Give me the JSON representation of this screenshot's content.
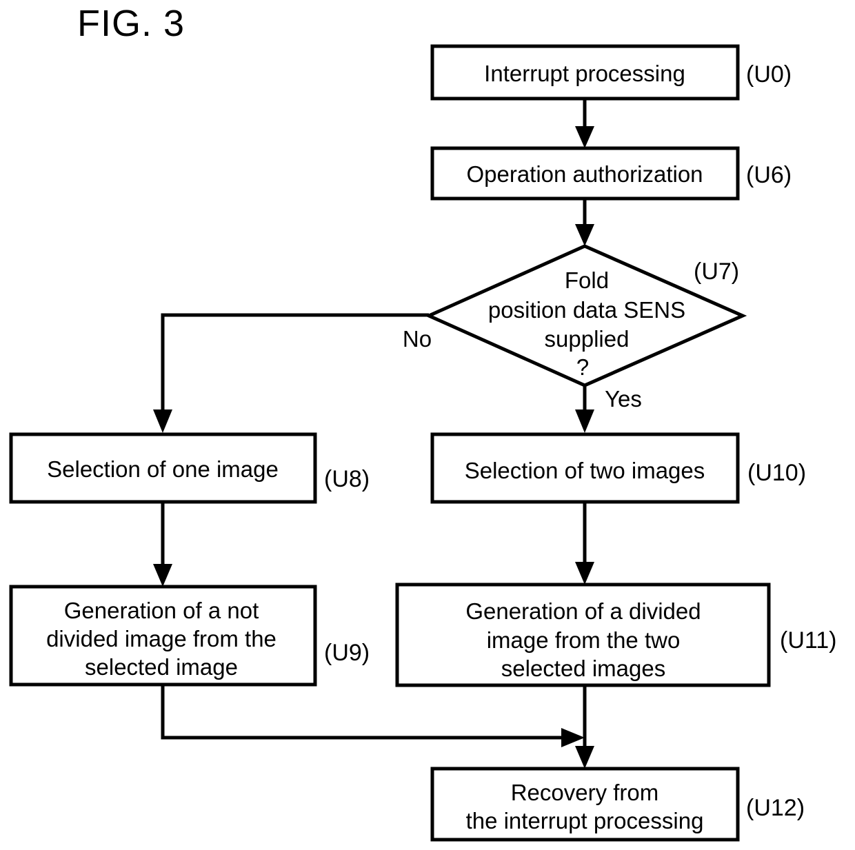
{
  "figure": {
    "title": "FIG. 3",
    "type": "flowchart"
  },
  "nodes": {
    "u0": {
      "label": "Interrupt processing",
      "ref": "(U0)",
      "shape": "process"
    },
    "u6": {
      "label": "Operation authorization",
      "ref": "(U6)",
      "shape": "process"
    },
    "u7": {
      "ref": "(U7)",
      "shape": "decision",
      "line1": "Fold",
      "line2": "position data SENS",
      "line3": "supplied",
      "line4": "?"
    },
    "u8": {
      "label": "Selection of one image",
      "ref": "(U8)",
      "shape": "process"
    },
    "u10": {
      "label": "Selection of two images",
      "ref": "(U10)",
      "shape": "process"
    },
    "u9": {
      "ref": "(U9)",
      "shape": "process",
      "line1": "Generation of a not",
      "line2": "divided image from the",
      "line3": "selected image"
    },
    "u11": {
      "ref": "(U11)",
      "shape": "process",
      "line1": "Generation of a divided",
      "line2": "image from the two",
      "line3": "selected images"
    },
    "u12": {
      "ref": "(U12)",
      "shape": "process",
      "line1": "Recovery from",
      "line2": "the interrupt processing"
    }
  },
  "edges": {
    "no_label": "No",
    "yes_label": "Yes"
  },
  "colors": {
    "stroke": "#000000",
    "fill": "#ffffff",
    "background": "#ffffff"
  }
}
